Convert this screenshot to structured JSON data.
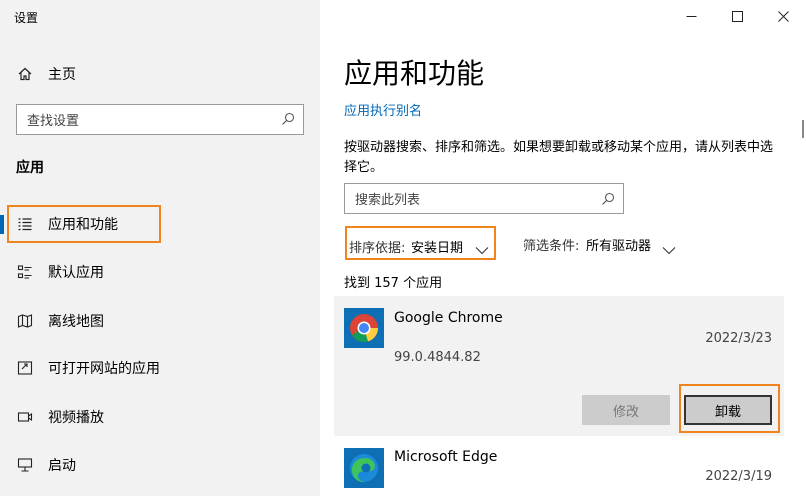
{
  "window": {
    "title": "设置"
  },
  "sidebar": {
    "home_label": "主页",
    "search_placeholder": "查找设置",
    "section_title": "应用",
    "items": [
      {
        "label": "应用和功能",
        "icon": "apps-list-icon",
        "selected": true
      },
      {
        "label": "默认应用",
        "icon": "default-apps-icon"
      },
      {
        "label": "离线地图",
        "icon": "offline-map-icon"
      },
      {
        "label": "可打开网站的应用",
        "icon": "web-apps-icon"
      },
      {
        "label": "视频播放",
        "icon": "video-playback-icon"
      },
      {
        "label": "启动",
        "icon": "startup-icon"
      }
    ]
  },
  "main": {
    "title": "应用和功能",
    "alias_link": "应用执行别名",
    "description": "按驱动器搜索、排序和筛选。如果想要卸载或移动某个应用，请从列表中选择它。",
    "search_placeholder": "搜索此列表",
    "sort_label": "排序依据:",
    "sort_value": "安装日期",
    "filter_label": "筛选条件:",
    "filter_value": "所有驱动器",
    "count_text": "找到 157 个应用",
    "apps": [
      {
        "name": "Google Chrome",
        "date": "2022/3/23",
        "version": "99.0.4844.82",
        "modify_label": "修改",
        "uninstall_label": "卸载"
      },
      {
        "name": "Microsoft Edge",
        "date": "2022/3/19"
      }
    ]
  },
  "colors": {
    "accent": "#0067b8",
    "highlight": "#f0841f",
    "sidebar_bg": "#f2f2f2",
    "selected_item_bg": "#e6e6e6"
  }
}
